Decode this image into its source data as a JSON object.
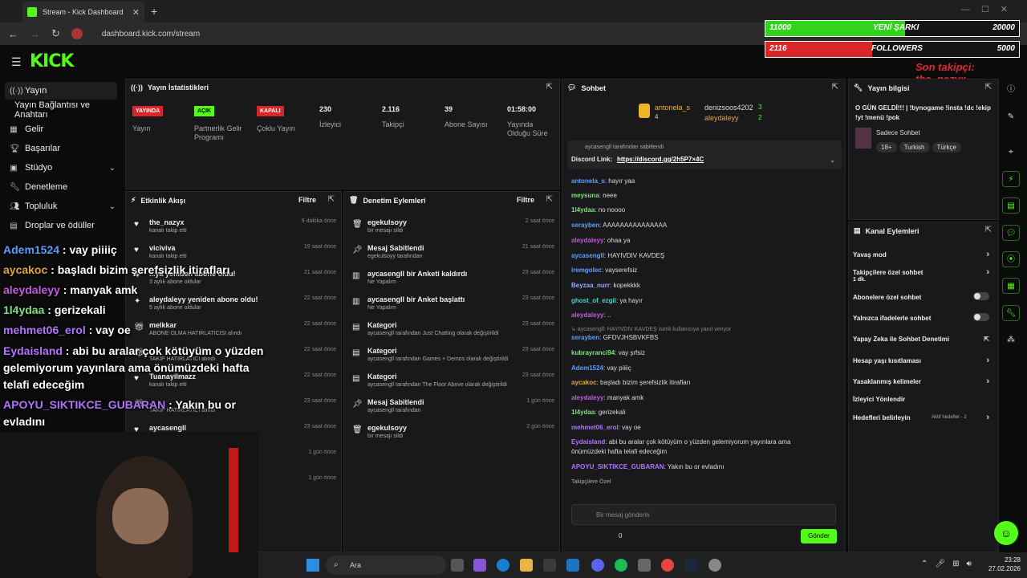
{
  "browser": {
    "tab_title": "Stream - Kick Dashboard",
    "url": "dashboard.kick.com/stream",
    "new_tab": "+"
  },
  "overlay": {
    "song_current": "11000",
    "song_label": "YENİ ŞARKI",
    "song_goal": "20000",
    "song_progress": 0.55,
    "followers_current": "2116",
    "followers_label": "FOLLOWERS",
    "followers_goal": "5000",
    "followers_progress": 0.42,
    "last_follower": "Son takipçi: the_nazyx"
  },
  "sidebar": {
    "items": [
      {
        "label": "Yayın",
        "icon": "broadcast-icon"
      },
      {
        "label": "Yayın Bağlantısı ve Anahtarı",
        "icon": ""
      },
      {
        "label": "Gelir",
        "icon": "revenue-icon"
      },
      {
        "label": "Başarılar",
        "icon": "trophy-icon"
      },
      {
        "label": "Stüdyo",
        "icon": "studio-icon"
      },
      {
        "label": "Denetleme",
        "icon": "moderation-icon"
      },
      {
        "label": "Topluluk",
        "icon": "community-icon"
      },
      {
        "label": "Droplar ve ödüller",
        "icon": "drops-icon"
      }
    ]
  },
  "overlay_chat": [
    {
      "user": "Adem1524",
      "text": " : vay piiiiç",
      "color": "#5aa0ff"
    },
    {
      "user": "aycakoc",
      "text": " : başladı bizim şerefsizlik itirafları",
      "color": "#e3a63b"
    },
    {
      "user": "aleydaleyy",
      "text": " : manyak amk",
      "color": "#c25be0"
    },
    {
      "user": "1l4ydaa",
      "text": " : gerizekali",
      "color": "#7ee07e"
    },
    {
      "user": "mehmet06_erol",
      "text": " : vay oe",
      "color": "#b274ff"
    },
    {
      "user": "Eydaisland",
      "text": " : abi bu aralar çok kötüyüm o yüzden",
      "color": "#b274ff"
    },
    {
      "user": "",
      "text": "gelemiyorum yayınlara ama önümüzdeki hafta",
      "color": "#fff"
    },
    {
      "user": "",
      "text": "telafi edeceğim",
      "color": "#fff"
    },
    {
      "user": "APOYU_SIKTIKCE_GUBARAN",
      "text": " : Yakın bu or",
      "color": "#b274ff"
    },
    {
      "user": "",
      "text": "evladını",
      "color": "#fff"
    }
  ],
  "stats": {
    "title": "Yayın İstatistikleri",
    "items": [
      {
        "badge": "YAYINDA",
        "label": "Yayın",
        "type": "red"
      },
      {
        "badge": "AÇIK",
        "label": "Partnerlik Gelir Programı",
        "type": "green"
      },
      {
        "badge": "KAPALI",
        "label": "Çoklu Yayın",
        "type": "red"
      },
      {
        "value": "230",
        "label": "İzleyici"
      },
      {
        "value": "2.116",
        "label": "Takipçi"
      },
      {
        "value": "39",
        "label": "Abone Sayısı"
      },
      {
        "value": "01:58:00",
        "label": "Yayında Olduğu Süre"
      }
    ]
  },
  "activity": {
    "title": "Etkinlik Akışı",
    "filter": "Filtre",
    "rows": [
      {
        "icon": "heart-icon",
        "title": "the_nazyx",
        "sub": "kanalı takip etti",
        "time": "9 dakika önce"
      },
      {
        "icon": "heart-icon",
        "title": "viciviva",
        "sub": "kanalı takip etti",
        "time": "19 saat önce"
      },
      {
        "icon": "sparkle-icon",
        "title": "...ya yeniden abone oldu!",
        "sub": "3 aylık abone oldular",
        "time": "21 saat önce"
      },
      {
        "icon": "sparkle-icon",
        "title": "aleydaleyy yeniden abone oldu!",
        "sub": "5 aylık abone oldular",
        "time": "22 saat önce"
      },
      {
        "icon": "gift-icon",
        "title": "melkkar",
        "sub": "ABONE OLMA HATIRLATICISI alındı",
        "time": "22 saat önce"
      },
      {
        "icon": "gift-icon",
        "title": "...",
        "sub": "TAKİP HATIRLATICI alındı",
        "time": "22 saat önce"
      },
      {
        "icon": "heart-icon",
        "title": "Tuanayilmazz",
        "sub": "kanalı takip etti",
        "time": "22 saat önce"
      },
      {
        "icon": "gift-icon",
        "title": "...",
        "sub": "TAKİP HATIRLATICI alındı",
        "time": "23 saat önce"
      },
      {
        "icon": "heart-icon",
        "title": "aycasengll",
        "sub": "",
        "time": "23 saat önce"
      },
      {
        "icon": "",
        "title": "",
        "sub": "",
        "time": "1 gün önce"
      },
      {
        "icon": "",
        "title": "",
        "sub": "",
        "time": "1 gün önce"
      }
    ]
  },
  "moderation": {
    "title": "Denetim Eylemleri",
    "filter": "Filtre",
    "rows": [
      {
        "icon": "trash-icon",
        "title": "egekulsoyy",
        "sub": "bir mesajı sildi",
        "time": "2 saat önce"
      },
      {
        "icon": "pin-icon",
        "title": "Mesaj Sabitlendi",
        "sub": "egekulsoyy tarafından",
        "time": "21 saat önce"
      },
      {
        "icon": "poll-icon",
        "title": "aycasengll bir Anketi kaldırdı",
        "sub": "Ne Yapalım",
        "time": "23 saat önce"
      },
      {
        "icon": "poll-icon",
        "title": "aycasengll bir Anket başlattı",
        "sub": "Ne Yapalım",
        "time": "23 saat önce"
      },
      {
        "icon": "category-icon",
        "title": "Kategori",
        "sub": "aycasengll tarafından Just Chatting olarak değiştirildi",
        "time": "23 saat önce"
      },
      {
        "icon": "category-icon",
        "title": "Kategori",
        "sub": "aycasengll tarafından Games + Demos olarak değiştirildi",
        "time": "23 saat önce"
      },
      {
        "icon": "category-icon",
        "title": "Kategori",
        "sub": "aycasengll tarafından The Floor Above olarak değiştirildi",
        "time": "23 saat önce"
      },
      {
        "icon": "pin-icon",
        "title": "Mesaj Sabitlendi",
        "sub": "aycasengll tarafından",
        "time": "1 gün önce"
      },
      {
        "icon": "trash-icon",
        "title": "egekulsoyy",
        "sub": "bir mesajı sildi",
        "time": "2 gün önce"
      }
    ]
  },
  "chat": {
    "title": "Sohbet",
    "top_gifter_1": "antonela_s",
    "top_gifter_1_count": "4",
    "top_gifter_2": "denizsoos4202",
    "top_gifter_2_count": "3",
    "top_gifter_3": "aleydaleyy",
    "top_gifter_3_count": "2",
    "pinned_by": "aycasengll tarafından sabitlendi",
    "pinned_label": "Discord Link:",
    "pinned_link": "https://discord.gg/2h5P7×4C",
    "messages": [
      {
        "user": "antonela_s",
        "text": ": hayır yaa",
        "color": "#5aa0ff"
      },
      {
        "user": "meysuna",
        "text": ": neee",
        "color": "#7ee07e"
      },
      {
        "user": "1l4ydaa",
        "text": ": no noooo",
        "color": "#7ee07e"
      },
      {
        "user": "serayben",
        "text": ": AAAAAAAAAAAAAAA",
        "color": "#5aa0ff"
      },
      {
        "user": "aleydaleyy",
        "text": ": ohaa ya",
        "color": "#c25be0"
      },
      {
        "user": "aycasengll",
        "text": ": HAYIVDIV KAVDEŞ",
        "color": "#5aa0ff"
      },
      {
        "user": "iremgolec",
        "text": ": vayserefsiz",
        "color": "#5aa0ff"
      },
      {
        "user": "Beyzaa_nurr",
        "text": ": kopekkkk",
        "color": "#9aa8ff"
      },
      {
        "user": "ghost_of_ezgii",
        "text": ": ya hayır",
        "color": "#4bd4c8"
      },
      {
        "user": "aleydaleyy",
        "text": ": ..",
        "color": "#c25be0"
      },
      {
        "user": "",
        "text": "↳ aycasengll: HAYIVDIV KAVDEŞ isimli kullanıcıya yanıt veriyor",
        "color": "#888"
      },
      {
        "user": "serayben",
        "text": ": GFDVJHSBVKFBS",
        "color": "#5aa0ff"
      },
      {
        "user": "kubrayranci94",
        "text": ": vay şrfsiz",
        "color": "#7ee07e"
      },
      {
        "user": "Adem1524",
        "text": ": vay piiiiç",
        "color": "#5aa0ff"
      },
      {
        "user": "aycakoc",
        "text": ": başladı bizim şerefsizlik itirafları",
        "color": "#e3a63b"
      },
      {
        "user": "aleydaleyy",
        "text": ": manyak amk",
        "color": "#c25be0"
      },
      {
        "user": "1l4ydaa",
        "text": ": gerizekali",
        "color": "#7ee07e"
      },
      {
        "user": "mehmet06_erol",
        "text": ": vay oe",
        "color": "#b274ff"
      },
      {
        "user": "Eydaisland",
        "text": ": abi bu aralar çok kötüyüm o yüzden gelemiyorum yayınlara ama",
        "color": "#b274ff"
      },
      {
        "user": "",
        "text": "önümüzdeki hafta telafi edeceğim",
        "color": "#ddd"
      },
      {
        "user": "APOYU_SIKTIKCE_GUBARAN",
        "text": ": Yakın bu or evladını",
        "color": "#b274ff"
      }
    ],
    "followers_only": "Takipçilere Özel",
    "input_placeholder": "Bir mesaj gönderin",
    "viewer_count": "0",
    "send_label": "Gönder"
  },
  "stream_info": {
    "title": "Yayın bilgisi",
    "stream_title": "O GÜN GELDİ!!! | !bynogame !insta !dc !ekip !yt !menü !pok",
    "category": "Sadece Sohbet",
    "tags": [
      "18+",
      "Turkish",
      "Türkçe"
    ]
  },
  "channel_actions": {
    "title": "Kanal Eylemleri",
    "items": [
      {
        "label": "Yavaş mod",
        "control": "chevron"
      },
      {
        "label": "Takipçilere özel sohbet",
        "sub": "1 dk.",
        "control": "chevron"
      },
      {
        "label": "Abonelere özel sohbet",
        "control": "toggle"
      },
      {
        "label": "Yalnızca ifadelerle sohbet",
        "control": "toggle"
      },
      {
        "label": "Yapay Zeka ile Sohbet Denetimi",
        "control": "external"
      },
      {
        "label": "Hesap yaşı kısıtlaması",
        "control": "chevron"
      },
      {
        "label": "Yasaklanmış kelimeler",
        "control": "chevron"
      },
      {
        "label": "İzleyici Yönlendir",
        "control": "none"
      },
      {
        "label": "Hedefleri belirleyin",
        "sub": "Aktif hedefler - 2",
        "control": "chevron"
      }
    ]
  },
  "taskbar": {
    "search_placeholder": "Ara",
    "time": "23:28",
    "date": "27.02.2026"
  },
  "colors": {
    "kick_green": "#53fc18",
    "panel_bg": "#19191b",
    "page_bg": "#0b0b0c"
  }
}
